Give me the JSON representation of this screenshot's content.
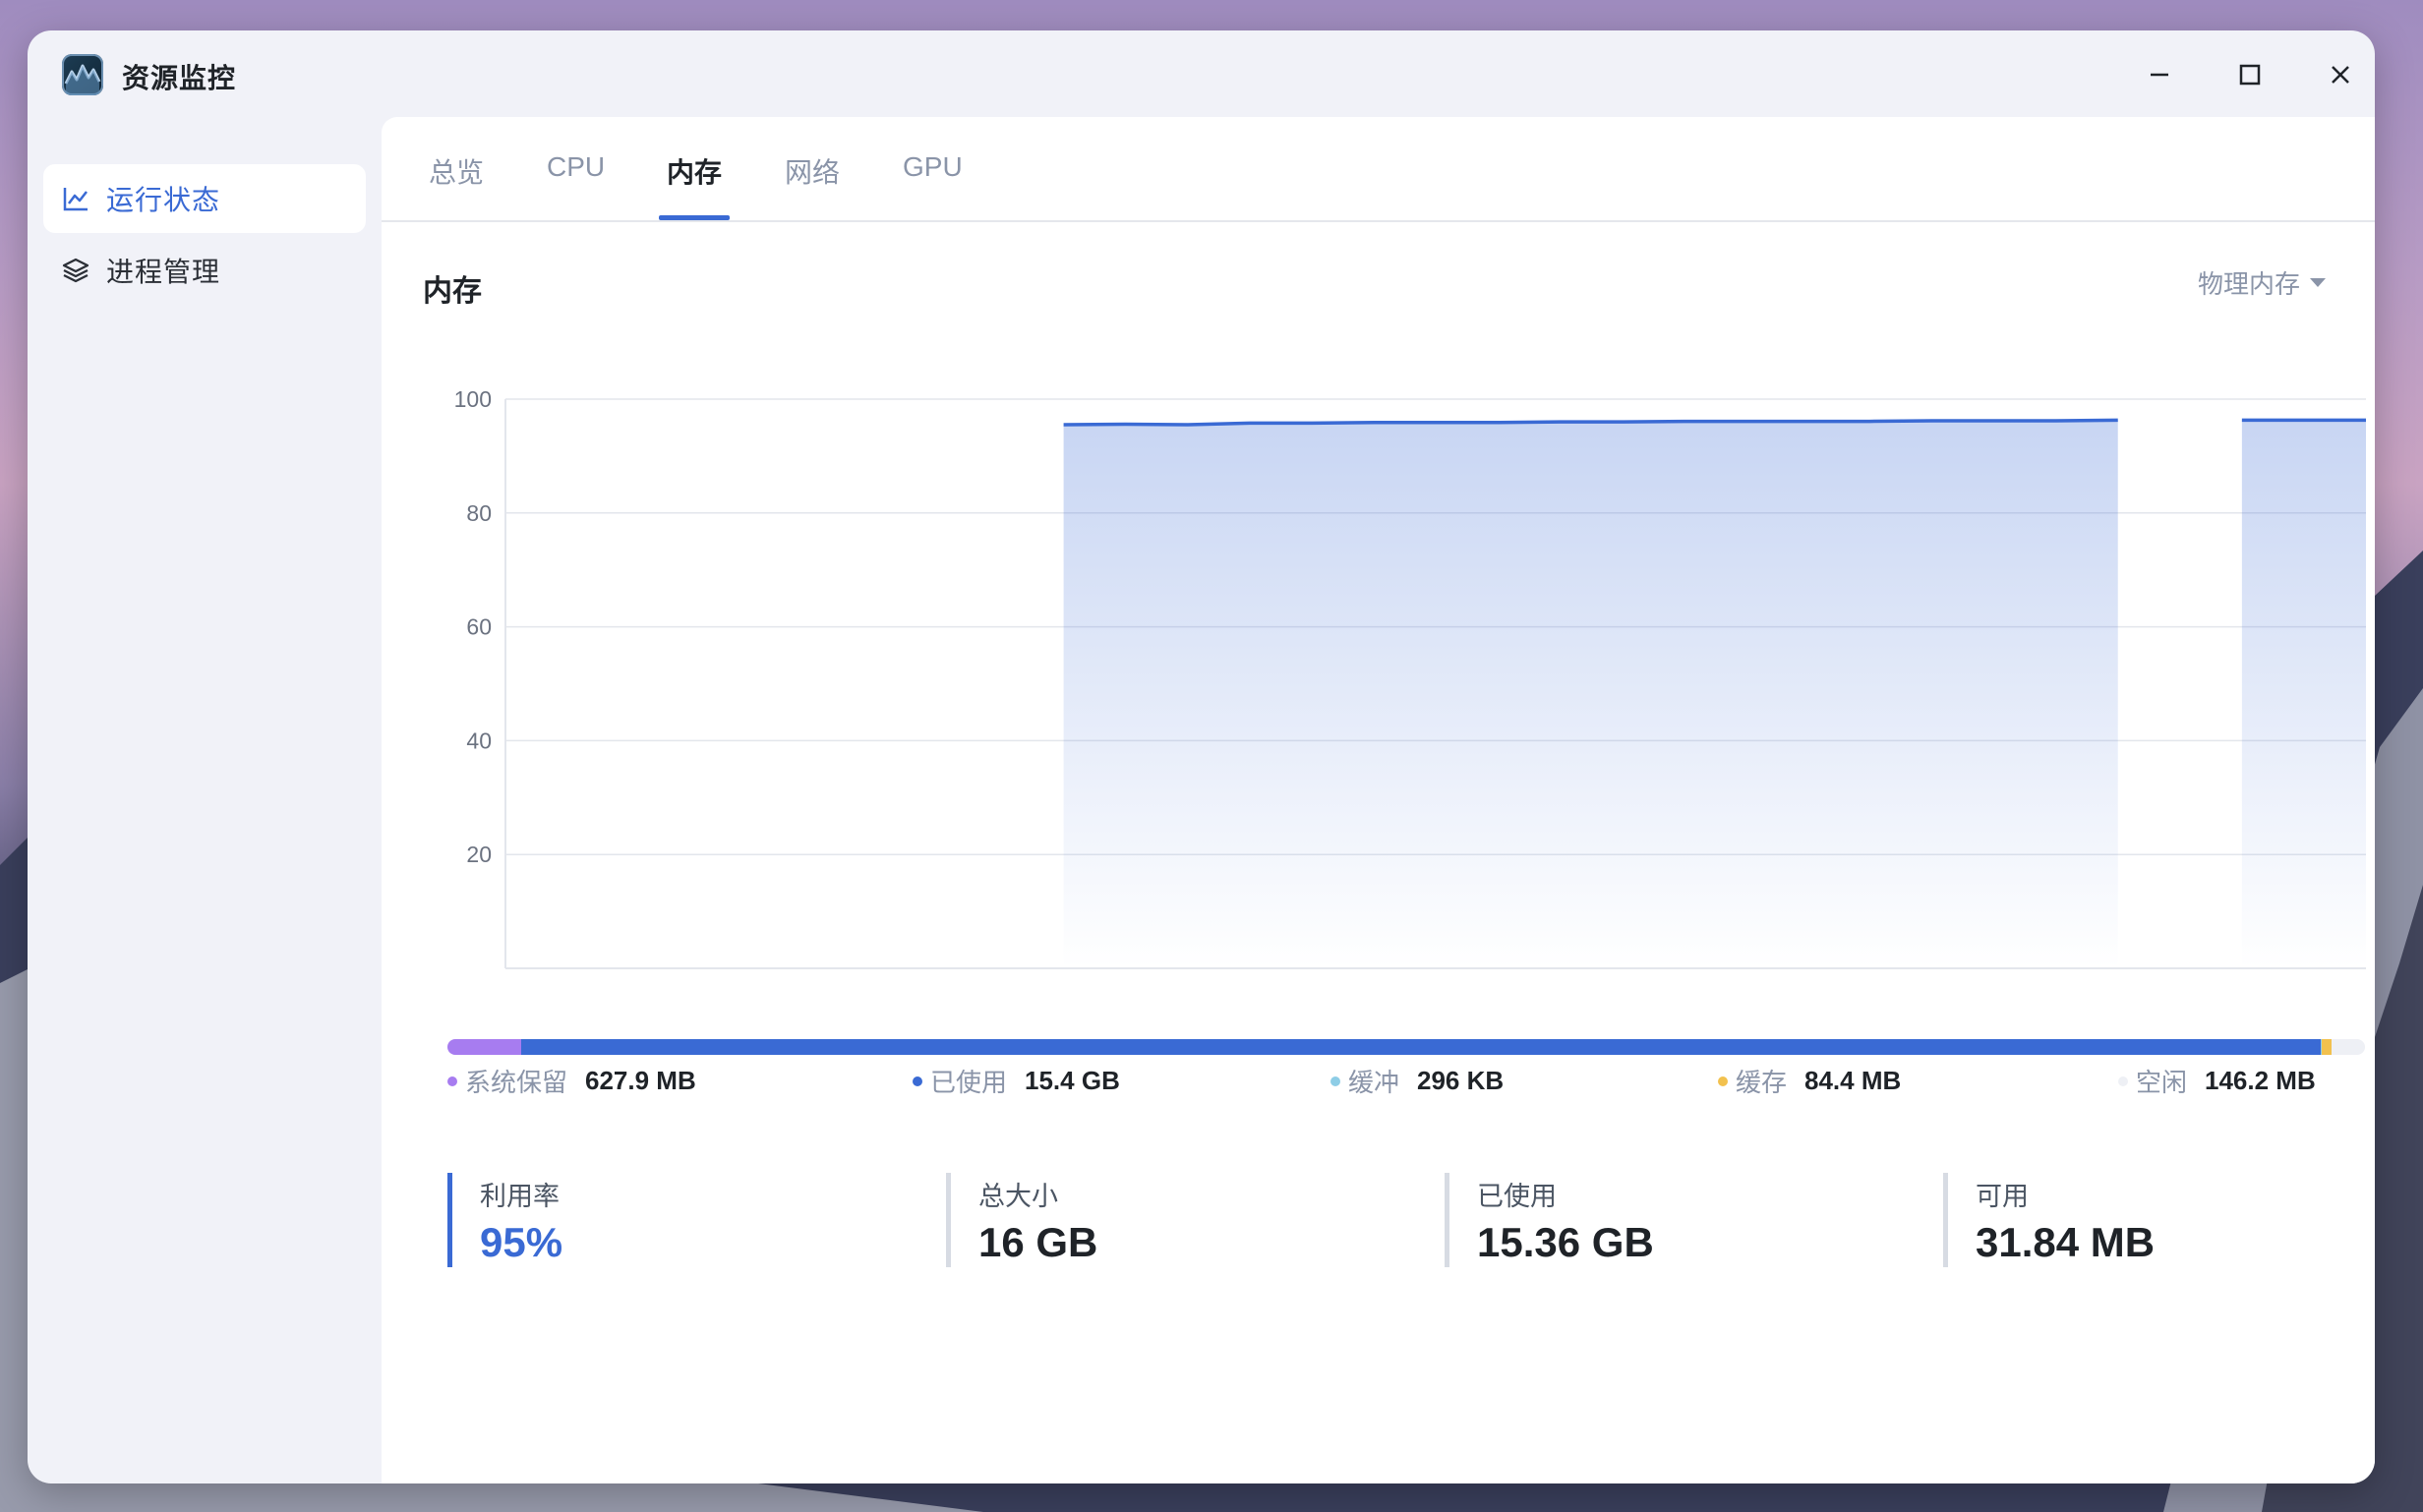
{
  "app": {
    "title": "资源监控",
    "icon": "activity-chart-app-icon"
  },
  "window_controls": {
    "minimize": "minimize-icon",
    "maximize": "maximize-icon",
    "close": "close-icon"
  },
  "sidebar": {
    "items": [
      {
        "label": "运行状态",
        "icon": "line-chart-icon",
        "active": true
      },
      {
        "label": "进程管理",
        "icon": "layers-icon",
        "active": false
      }
    ]
  },
  "tabs": [
    {
      "label": "总览",
      "active": false
    },
    {
      "label": "CPU",
      "active": false
    },
    {
      "label": "内存",
      "active": true
    },
    {
      "label": "网络",
      "active": false
    },
    {
      "label": "GPU",
      "active": false
    }
  ],
  "section": {
    "title": "内存",
    "dropdown_label": "物理内存"
  },
  "colors": {
    "accent": "#3a6ad4",
    "reserved": "#a77cf0",
    "used": "#3a6ad4",
    "buffer": "#8ecde6",
    "cache": "#f2c14e",
    "free": "#eef0f5"
  },
  "chart_data": {
    "type": "area",
    "ylim": [
      0,
      100
    ],
    "yticks": [
      20,
      40,
      60,
      80,
      100
    ],
    "grid": true,
    "x": [
      0,
      2,
      4,
      6,
      8,
      10,
      12,
      14,
      16,
      18,
      20,
      22,
      24,
      26,
      28,
      30,
      32,
      34,
      36,
      38,
      40,
      42,
      44,
      46,
      48,
      50,
      52,
      54,
      56,
      58,
      60
    ],
    "series": [
      {
        "values": [
          null,
          null,
          null,
          null,
          null,
          null,
          null,
          null,
          null,
          95.5,
          95.6,
          95.5,
          95.8,
          95.8,
          95.9,
          95.9,
          95.9,
          96.0,
          96.0,
          96.1,
          96.1,
          96.1,
          96.1,
          96.2,
          96.2,
          96.2,
          96.3,
          null,
          96.3,
          96.3,
          96.3
        ]
      }
    ]
  },
  "memory_breakdown": [
    {
      "name": "系统保留",
      "value": "627.9 MB",
      "color": "#a77cf0",
      "fraction": 0.0383
    },
    {
      "name": "已使用",
      "value": "15.4 GB",
      "color": "#3a6ad4",
      "fraction": 0.9388
    },
    {
      "name": "缓冲",
      "value": "296 KB",
      "color": "#8ecde6",
      "fraction": 0.0005
    },
    {
      "name": "缓存",
      "value": "84.4 MB",
      "color": "#f2c14e",
      "fraction": 0.0052
    },
    {
      "name": "空闲",
      "value": "146.2 MB",
      "color": "#eef0f5",
      "fraction": 0.0089
    }
  ],
  "stats": [
    {
      "label": "利用率",
      "value": "95%",
      "accent": true
    },
    {
      "label": "总大小",
      "value": "16 GB",
      "accent": false
    },
    {
      "label": "已使用",
      "value": "15.36 GB",
      "accent": false
    },
    {
      "label": "可用",
      "value": "31.84 MB",
      "accent": false
    }
  ]
}
